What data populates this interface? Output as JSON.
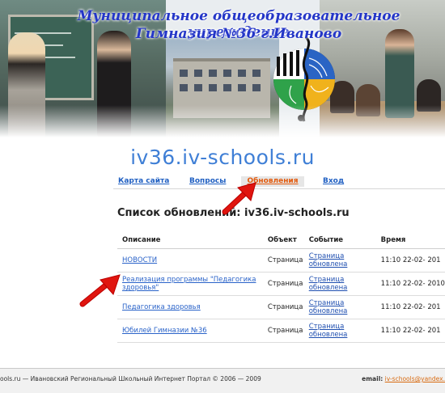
{
  "banner": {
    "title_line1": "Муниципальное общеобразовательное учреждение",
    "title_line2": "Гимназия №36 г.Иваново"
  },
  "site_name": "iv36.iv-schools.ru",
  "nav": {
    "sitemap": "Карта сайта",
    "questions": "Вопросы",
    "updates": "Обновления",
    "login": "Вход"
  },
  "list_title": "Список обновлений: iv36.iv-schools.ru",
  "table": {
    "headers": {
      "description": "Описание",
      "object": "Объект",
      "event": "Событие",
      "time": "Время"
    },
    "rows": [
      {
        "description": "НОВОСТИ",
        "object": "Страница",
        "event": "Страница обновлена",
        "time": "11:10 22-02- 201"
      },
      {
        "description": "Реализация программы \"Педагогика здоровья\"",
        "object": "Страница",
        "event": "Страница обновлена",
        "time": "11:10 22-02- 2010"
      },
      {
        "description": "Педагогика здоровья",
        "object": "Страница",
        "event": "Страница обновлена",
        "time": "11:10 22-02- 201"
      },
      {
        "description": "Юбилей Гимназии №36",
        "object": "Страница",
        "event": "Страница обновлена",
        "time": "11:10 22-02- 201"
      }
    ]
  },
  "footer": {
    "left": "ools.ru — Ивановский Региональный Школьный Интернет Портал ©  2006 — 2009",
    "email_label": "email:",
    "email": "iv-schools@yandex."
  },
  "colors": {
    "title_blue": "#2436c8",
    "site_name_blue": "#3f7fd6",
    "link_blue": "#1f5fc2",
    "active_orange": "#e35b0e",
    "arrow_red": "#e0150f"
  }
}
